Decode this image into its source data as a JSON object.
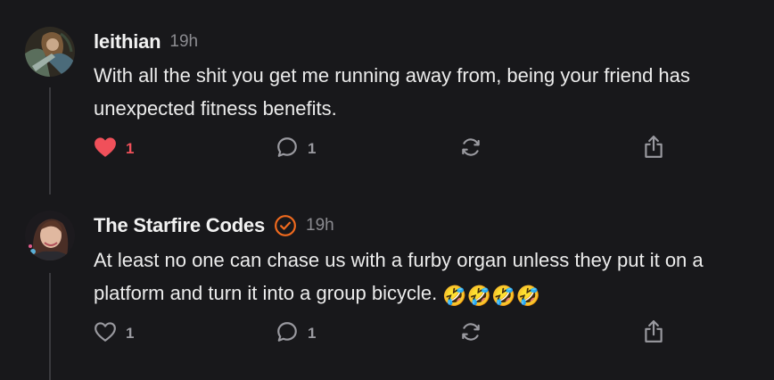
{
  "posts": [
    {
      "author": "leithian",
      "time": "19h",
      "text": "With all the shit you get me running away from, being your friend has unexpected fitness benefits.",
      "likes": "1",
      "replies": "1",
      "liked": true,
      "verified": false
    },
    {
      "author": "The Starfire Codes",
      "time": "19h",
      "text": "At least no one can chase us with a furby organ unless they put it on a platform and turn it into a group bicycle.",
      "emoji": "🤣🤣🤣🤣",
      "likes": "1",
      "replies": "1",
      "liked": false,
      "verified": true
    }
  ],
  "colors": {
    "background": "#18181b",
    "like_active": "#f0505a",
    "verified_badge": "#f06a1e",
    "icon": "#9a9aa0"
  },
  "icons": {
    "like": "heart-icon",
    "reply": "speech-bubble-icon",
    "repost": "repost-arrows-icon",
    "share": "share-up-arrow-icon",
    "verified": "verified-check-badge-icon"
  }
}
